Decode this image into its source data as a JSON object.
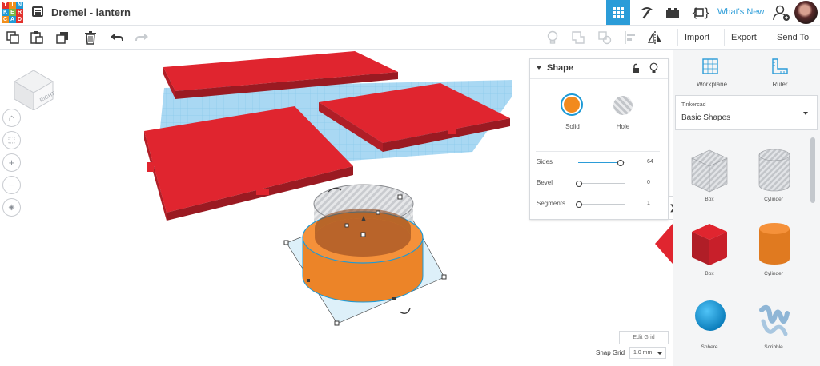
{
  "app": {
    "logo_letters": [
      "T",
      "I",
      "N",
      "K",
      "E",
      "R",
      "C",
      "A",
      "D"
    ],
    "logo_colors": [
      "#e2312c",
      "#f28f1c",
      "#1f9ad6",
      "#1f9ad6",
      "#7ab648",
      "#e2312c",
      "#f28f1c",
      "#1f9ad6",
      "#e2312c"
    ],
    "document_title": "Dremel - lantern",
    "whats_new": "What's New",
    "accent_color": "#2b9cd8"
  },
  "topbar_icons": [
    "3d-view-icon",
    "pickaxe-icon",
    "bricks-icon",
    "codeblocks-icon",
    "add-user-icon"
  ],
  "toolbar": {
    "import_label": "Import",
    "export_label": "Export",
    "send_to_label": "Send To"
  },
  "viewcube": {
    "face_label": "RIGHT"
  },
  "inspector": {
    "title": "Shape",
    "solid_label": "Solid",
    "hole_label": "Hole",
    "solid_color": "#f28a1e",
    "properties": [
      {
        "label": "Sides",
        "value": "64",
        "fraction": 0.9
      },
      {
        "label": "Bevel",
        "value": "0",
        "fraction": 0.0
      },
      {
        "label": "Segments",
        "value": "1",
        "fraction": 0.0
      }
    ]
  },
  "sidebar": {
    "workplane_label": "Workplane",
    "ruler_label": "Ruler",
    "library_label": "Tinkercad",
    "library_value": "Basic Shapes",
    "shapes": [
      {
        "label": "Box",
        "kind": "box-hole"
      },
      {
        "label": "Cylinder",
        "kind": "cylinder-hole"
      },
      {
        "label": "Box",
        "kind": "box-solid"
      },
      {
        "label": "Cylinder",
        "kind": "cylinder-solid"
      },
      {
        "label": "Sphere",
        "kind": "sphere"
      },
      {
        "label": "Scribble",
        "kind": "scribble"
      }
    ]
  },
  "grid": {
    "edit_grid_label": "Edit Grid",
    "snap_grid_label": "Snap Grid",
    "snap_grid_value": "1.0 mm"
  }
}
